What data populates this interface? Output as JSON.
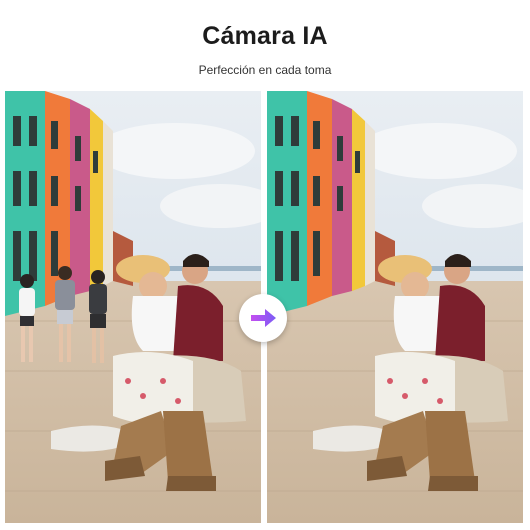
{
  "header": {
    "title": "Cámara IA",
    "subtitle": "Perfección en cada toma"
  },
  "comparison": {
    "before_image": "street-couple-with-tourists",
    "after_image": "street-couple-tourists-removed",
    "transition_icon": "arrow-right-icon"
  },
  "colors": {
    "arrow_gradient_start": "#c44ff0",
    "arrow_gradient_end": "#7b5cf5"
  }
}
